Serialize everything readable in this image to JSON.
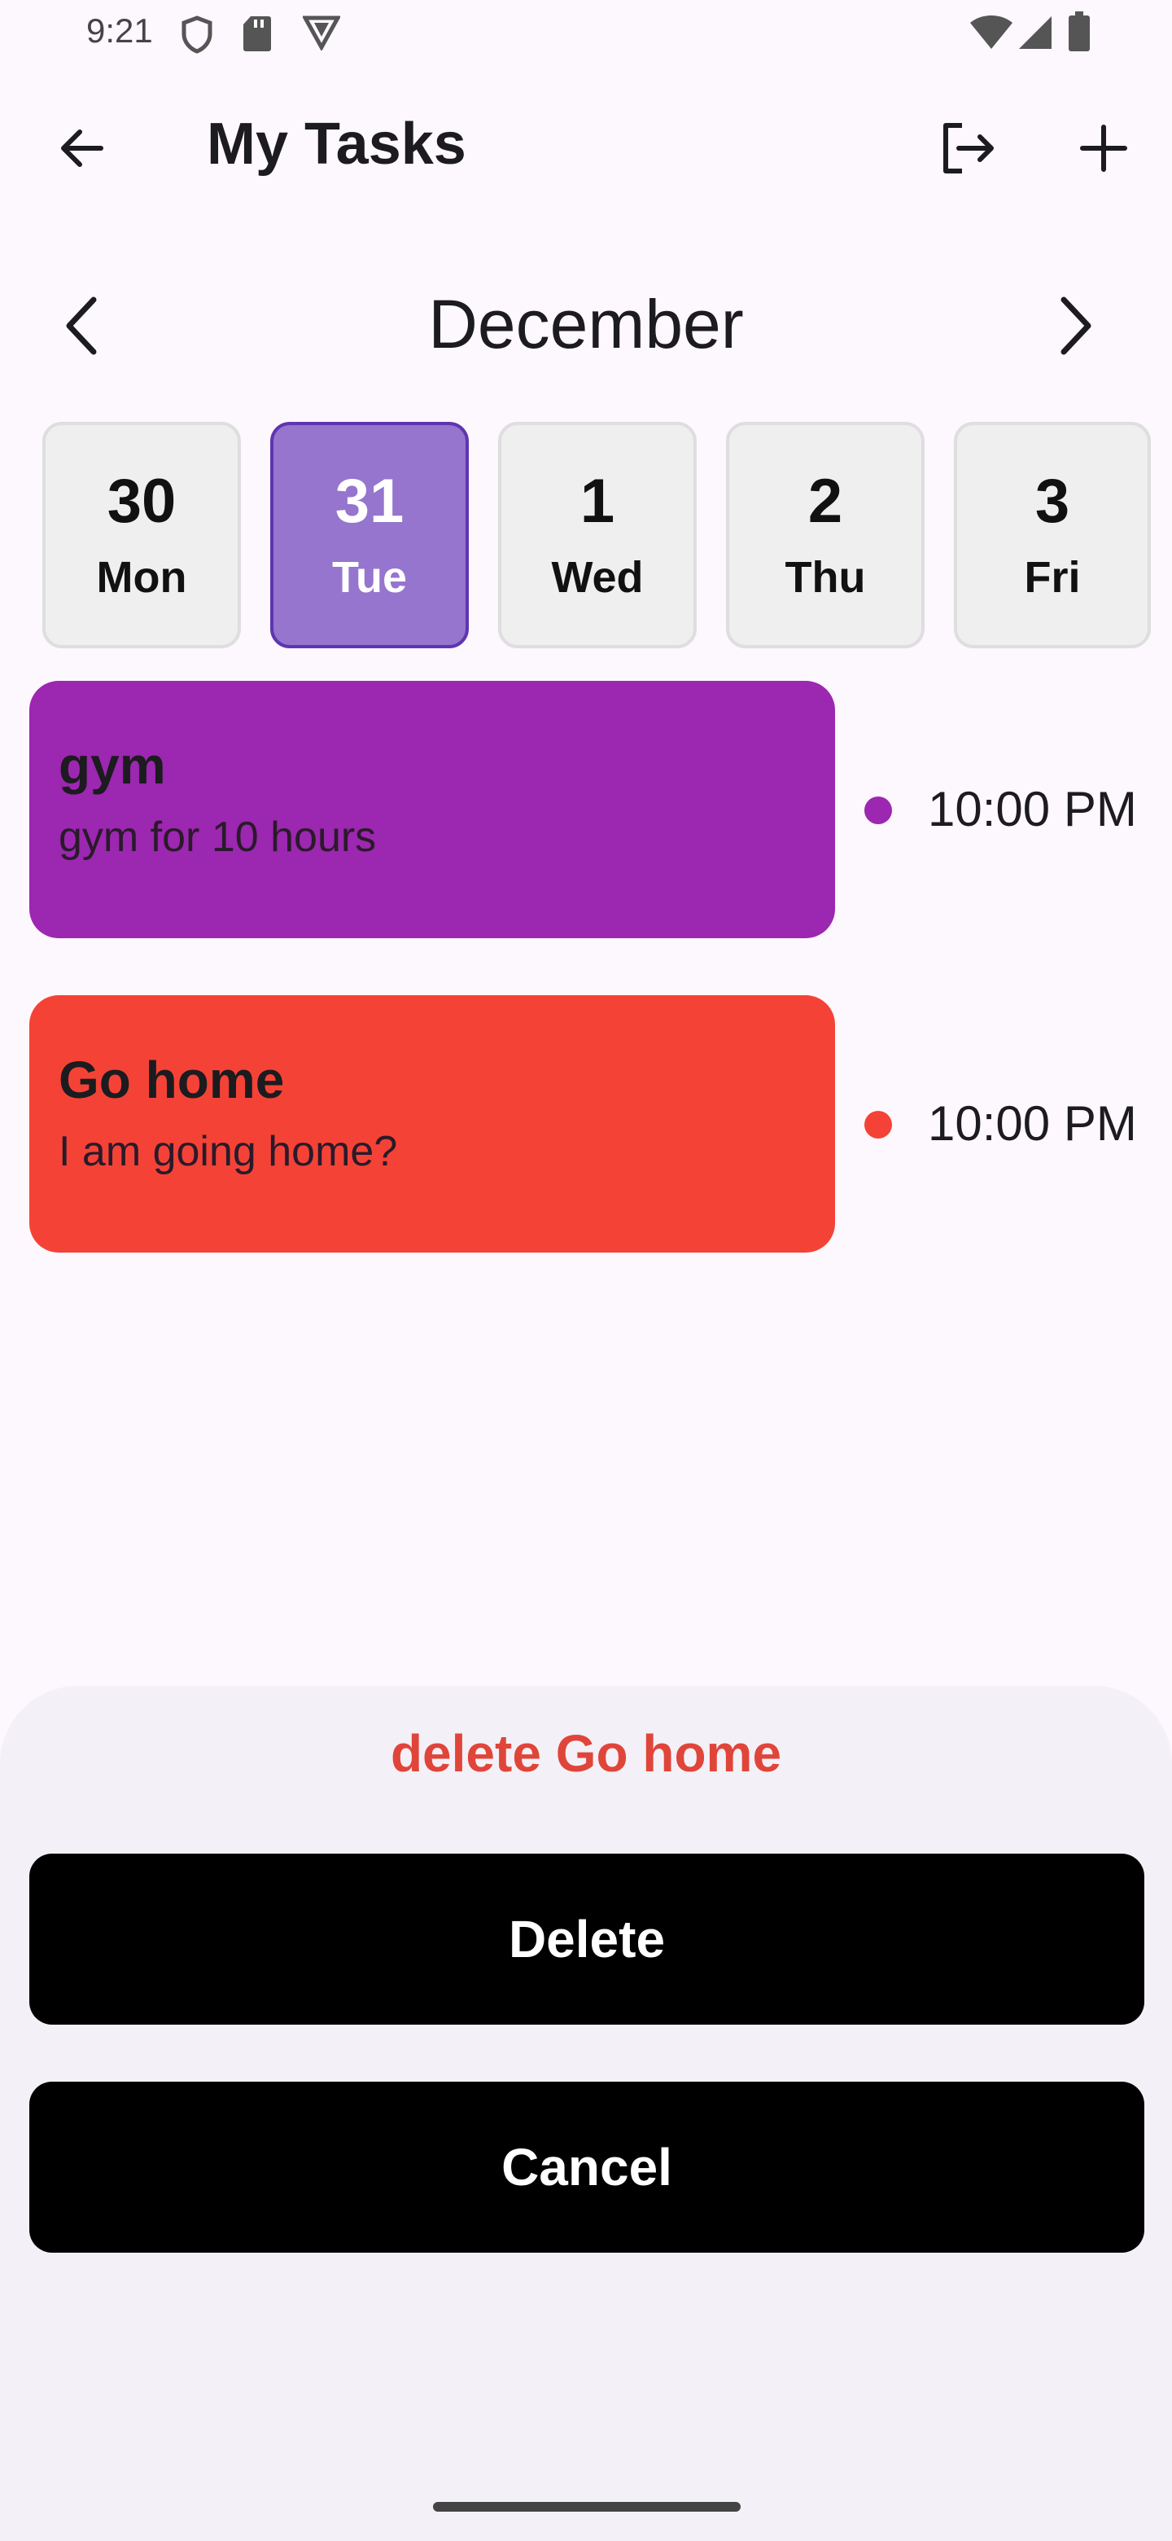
{
  "status_bar": {
    "time": "9:21",
    "icons": [
      "shield-icon",
      "sd-card-icon",
      "vpn-icon",
      "wifi-icon",
      "signal-icon",
      "battery-icon"
    ]
  },
  "app_bar": {
    "title": "My Tasks",
    "icons": [
      "back-arrow-icon",
      "logout-icon",
      "plus-icon"
    ]
  },
  "month_nav": {
    "month": "December",
    "icons": [
      "chevron-left-icon",
      "chevron-right-icon"
    ]
  },
  "dates": [
    {
      "num": "30",
      "day": "Mon",
      "selected": false
    },
    {
      "num": "31",
      "day": "Tue",
      "selected": true
    },
    {
      "num": "1",
      "day": "Wed",
      "selected": false
    },
    {
      "num": "2",
      "day": "Thu",
      "selected": false
    },
    {
      "num": "3",
      "day": "Fri",
      "selected": false
    }
  ],
  "tasks": [
    {
      "title": "gym",
      "description": "gym for 10 hours",
      "time": "10:00 PM",
      "color": "#9C27B0"
    },
    {
      "title": "Go home",
      "description": "I am going home?",
      "time": "10:00 PM",
      "color": "#F44336"
    }
  ],
  "sheet": {
    "title": "delete Go home",
    "delete_label": "Delete",
    "cancel_label": "Cancel",
    "title_color": "#E0453A"
  },
  "colors": {
    "background": "#FDF7FE",
    "selected_date": "#9575CD",
    "selected_border": "#5E35B1",
    "sheet_background": "#F4F0F7"
  }
}
